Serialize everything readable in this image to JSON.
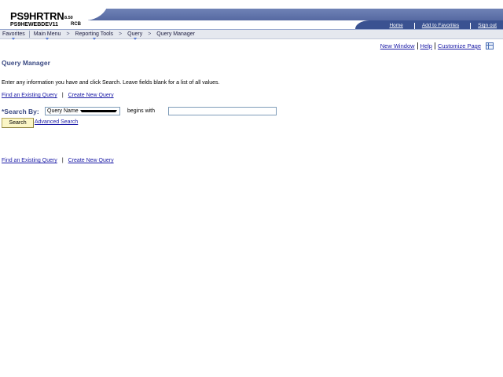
{
  "banner": {
    "database": "PS9HRTRN",
    "version": "8.50",
    "node": "PS9HEWEBDEV11",
    "user": "RCB",
    "links": [
      "Home",
      "Add to Favorites",
      "Sign out"
    ]
  },
  "nav": {
    "favorites": "Favorites",
    "main_menu": "Main Menu",
    "reporting_tools": "Reporting Tools",
    "query": "Query",
    "current": "Query Manager",
    "separator": ">"
  },
  "page_links": {
    "new_window": "New Window",
    "help": "Help",
    "customize": "Customize Page"
  },
  "main": {
    "title": "Query Manager",
    "instructions": "Enter any information you have and click Search. Leave fields blank for a list of all values.",
    "find_existing": "Find an Existing Query",
    "create_new": "Create New Query",
    "pipe": "|",
    "search_by_label": "*Search By:",
    "search_by_value": "Query Name",
    "operator": "begins with",
    "search_value": "",
    "search_button": "Search",
    "advanced_search": "Advanced Search"
  },
  "colors": {
    "banner_blue": "#5669a2",
    "banner_dark_blue": "#3a5291",
    "title_blue": "#3c4b84",
    "link_blue": "#1a1aa6",
    "button_yellow": "#fbf6c6"
  },
  "icons": {
    "customize": "grid-icon",
    "nav_dropdown": "triangle-down-icon",
    "select_arrow": "chevron-down-icon"
  }
}
